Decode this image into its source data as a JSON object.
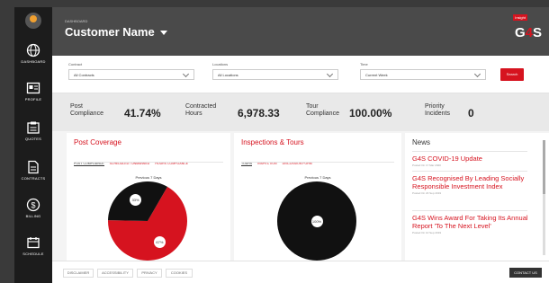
{
  "header": {
    "breadcrumb": "Dashboard",
    "title": "Customer Name",
    "logo_tag": "Insight",
    "logo_g": "G",
    "logo_4": "4",
    "logo_s": "S"
  },
  "sidebar": {
    "items": [
      {
        "label": "Dashboard",
        "icon": "globe-icon"
      },
      {
        "label": "Profile",
        "icon": "profile-card-icon"
      },
      {
        "label": "Quotes",
        "icon": "clipboard-icon"
      },
      {
        "label": "Contracts",
        "icon": "document-icon"
      },
      {
        "label": "Billing",
        "icon": "dollar-icon"
      },
      {
        "label": "Schedule",
        "icon": "calendar-icon"
      }
    ]
  },
  "filters": {
    "contract": {
      "label": "Contract",
      "value": "All Contracts"
    },
    "locations": {
      "label": "Locations",
      "value": "All Locations"
    },
    "time": {
      "label": "Time",
      "value": "Current Week"
    },
    "search_label": "Search"
  },
  "kpis": [
    {
      "label_1": "Post",
      "label_2": "Compliance",
      "value": "41.74%"
    },
    {
      "label_1": "Contracted",
      "label_2": "Hours",
      "value": "6,978.33"
    },
    {
      "label_1": "Tour",
      "label_2": "Compliance",
      "value": "100.00%"
    },
    {
      "label_1": "Priority",
      "label_2": "Incidents",
      "value": "0"
    }
  ],
  "post_coverage": {
    "title": "Post Coverage",
    "tabs": [
      "Post Compliance",
      "Scheduled / Unmanned",
      "Hours Compliance"
    ],
    "period": "Previous 7 Days",
    "chart_data": {
      "type": "pie",
      "values": [
        67,
        33
      ],
      "labels": [
        "67%",
        "33%"
      ],
      "colors": [
        "#d6131f",
        "#111111"
      ]
    }
  },
  "inspections": {
    "title": "Inspections & Tours",
    "tabs": [
      "Tours",
      "Inspection",
      "Discussion Form"
    ],
    "period": "Previous 7 Days",
    "chart_data": {
      "type": "pie",
      "values": [
        100
      ],
      "labels": [
        "100%"
      ],
      "colors": [
        "#111111"
      ]
    }
  },
  "news": {
    "title": "News",
    "items": [
      {
        "headline": "G4S COVID-19 Update",
        "date": "Posted On 17 Mar 2020"
      },
      {
        "headline": "G4S Recognised By Leading Socially Responsible Investment Index",
        "date": "Posted On 23 Sep 2019"
      },
      {
        "headline": "G4S Wins Award For Taking Its Annual Report 'To The Next Level'",
        "date": "Posted On 10 Sep 2019"
      }
    ]
  },
  "footer": {
    "links": [
      "Disclaimer",
      "Accessibility",
      "Privacy",
      "Cookies"
    ],
    "contact_label": "Contact Us"
  }
}
